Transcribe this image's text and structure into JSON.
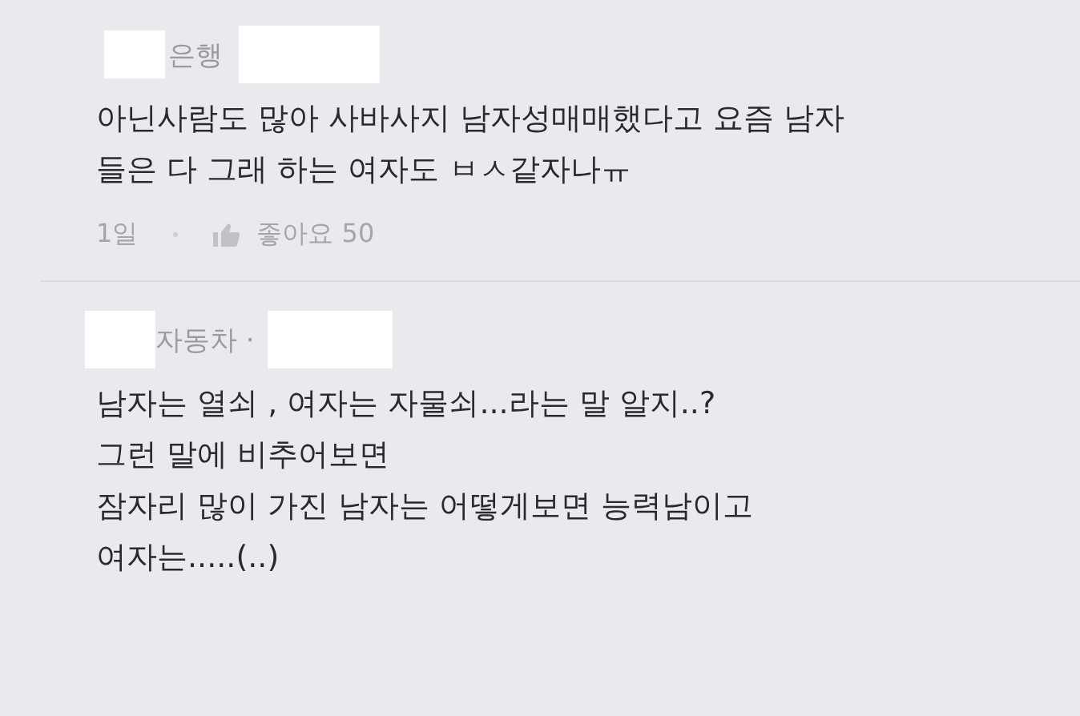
{
  "comments": [
    {
      "author": "은행",
      "lines": [
        "아닌사람도 많아 사바사지 남자성매매했다고 요즘 남자",
        "들은 다 그래 하는 여자도 ㅂㅅ같자나ㅠ"
      ],
      "time": "1일",
      "likes": "좋아요 50"
    },
    {
      "author": "자동차 ·",
      "lines": [
        "남자는 열쇠 , 여자는 자물쇠...라는 말 알지..?",
        "그런 말에 비추어보면",
        "잠자리 많이 가진 남자는 어떻게보면 능력남이고",
        "여자는.....(..)"
      ]
    }
  ]
}
